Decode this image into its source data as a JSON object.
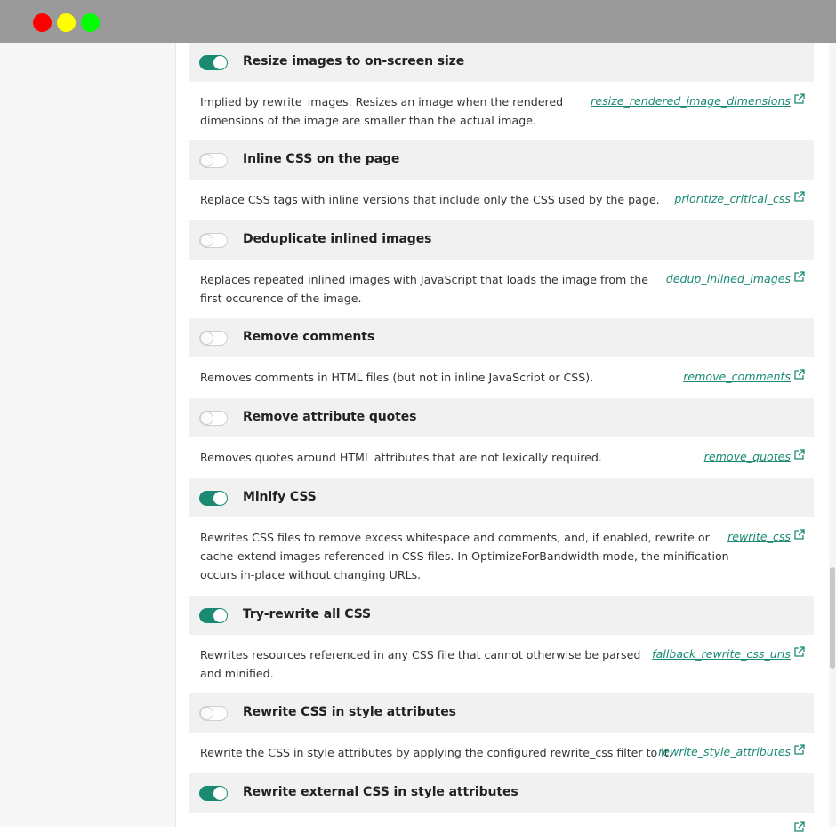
{
  "window": {
    "controls": [
      "close",
      "minimize",
      "maximize"
    ]
  },
  "colors": {
    "accent": "#1a8a73",
    "header_bg": "#f1f1f1",
    "titlebar": "#9a9a9a"
  },
  "filters": [
    {
      "title": "Resize images to on-screen size",
      "enabled": true,
      "description": "Implied by rewrite_images. Resizes an image when the rendered dimensions of the image are smaller than the actual image.",
      "link": "resize_rendered_image_dimensions"
    },
    {
      "title": "Inline CSS on the page",
      "enabled": false,
      "description": "Replace CSS tags with inline versions that include only the CSS used by the page.",
      "link": "prioritize_critical_css"
    },
    {
      "title": "Deduplicate inlined images",
      "enabled": false,
      "description": "Replaces repeated inlined images with JavaScript that loads the image from the first occurence of the image.",
      "link": "dedup_inlined_images"
    },
    {
      "title": "Remove comments",
      "enabled": false,
      "description": "Removes comments in HTML files (but not in inline JavaScript or CSS).",
      "link": "remove_comments"
    },
    {
      "title": "Remove attribute quotes",
      "enabled": false,
      "description": "Removes quotes around HTML attributes that are not lexically required.",
      "link": "remove_quotes"
    },
    {
      "title": "Minify CSS",
      "enabled": true,
      "description": "Rewrites CSS files to remove excess whitespace and comments, and, if enabled, rewrite or cache-extend images referenced in CSS files. In OptimizeForBandwidth mode, the minification occurs in-place without changing URLs.",
      "link": "rewrite_css"
    },
    {
      "title": "Try-rewrite all CSS",
      "enabled": true,
      "description": "Rewrites resources referenced in any CSS file that cannot otherwise be parsed and minified.",
      "link": "fallback_rewrite_css_urls"
    },
    {
      "title": "Rewrite CSS in style attributes",
      "enabled": false,
      "description": "Rewrite the CSS in style attributes by applying the configured rewrite_css filter to it.",
      "link": "rewrite_style_attributes"
    },
    {
      "title": "Rewrite external CSS in style attributes",
      "enabled": true,
      "description": "",
      "link": ""
    }
  ]
}
